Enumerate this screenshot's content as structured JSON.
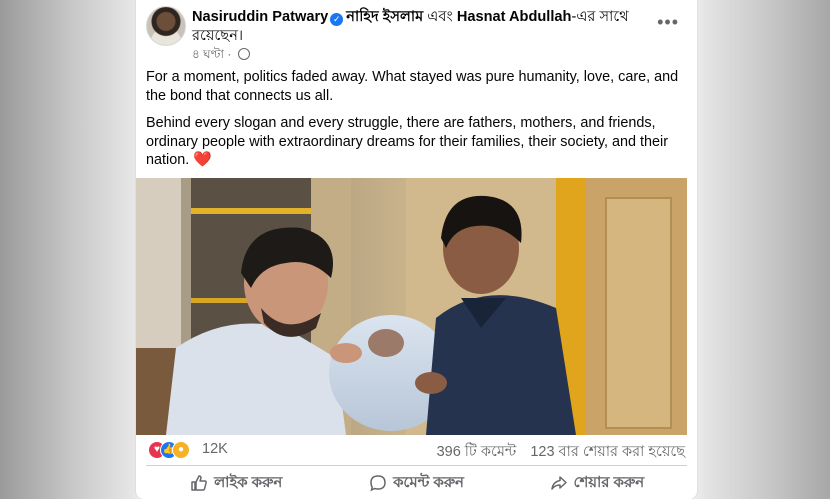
{
  "post": {
    "author": "Nasiruddin Patwary",
    "tagged_1": "নাহিদ ইসলাম",
    "conjunction": "এবং",
    "tagged_2": "Hasnat Abdullah",
    "with_suffix": "-এর সাথে রয়েছেন।",
    "time": "৪ ঘণ্টা",
    "separator": "·",
    "paragraph_1": "For a moment, politics faded away. What stayed was pure humanity, love, care, and the bond that connects us all.",
    "paragraph_2": "Behind every slogan and every struggle, there are fathers, mothers, and friends, ordinary people with extraordinary dreams for their families, their society, and their nation.",
    "heart": "❤️",
    "more_icon": "•••"
  },
  "reactions": {
    "count": "12K",
    "comments": "396 টি কমেন্ট",
    "shares": "123 বার শেয়ার করা হয়েছে"
  },
  "actions": {
    "like": "লাইক করুন",
    "comment": "কমেন্ট করুন",
    "share": "শেয়ার করুন"
  },
  "colors": {
    "accent": "#1877f2",
    "secondary_text": "#65676b",
    "love": "#e8344e",
    "care": "#f7b125"
  },
  "icons": [
    "verified-badge-icon",
    "globe-icon",
    "more-options-icon",
    "love-reaction-icon",
    "like-reaction-icon",
    "care-reaction-icon",
    "thumbs-up-icon",
    "comment-bubble-icon",
    "share-arrow-icon"
  ]
}
